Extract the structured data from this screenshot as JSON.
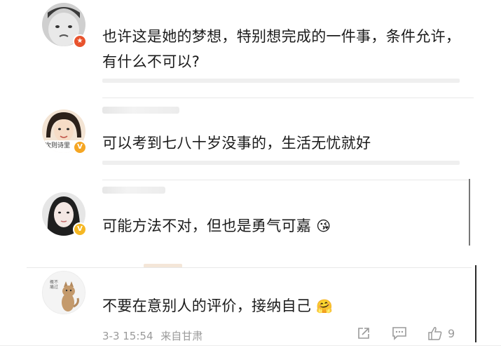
{
  "comments": [
    {
      "text": "也许这是她的梦想，特别想完成的一件事，条件允许，有什么不可以?",
      "badge_color": "#e8532d",
      "badge_icon": "star-badge-icon"
    },
    {
      "text": "可以考到七八十岁没事的，生活无忧就好",
      "badge_color": "#f5a623",
      "badge_icon": "verified-v-icon",
      "avatar_caption": "次则诗里"
    },
    {
      "text": "可能方法不对，但也是勇气可嘉",
      "emoji": "😘",
      "badge_color": "#f5b723",
      "badge_icon": "verified-v-icon"
    },
    {
      "text": "不要在意别人的评价，接纳自己",
      "emoji": "🤗",
      "avatar_caption": "概不痛过",
      "date": "3-3 15:54",
      "location": "来自甘肃",
      "like_count": "9"
    }
  ],
  "icons": {
    "share": "share-icon",
    "comment": "comment-icon",
    "like": "thumbs-up-icon"
  }
}
